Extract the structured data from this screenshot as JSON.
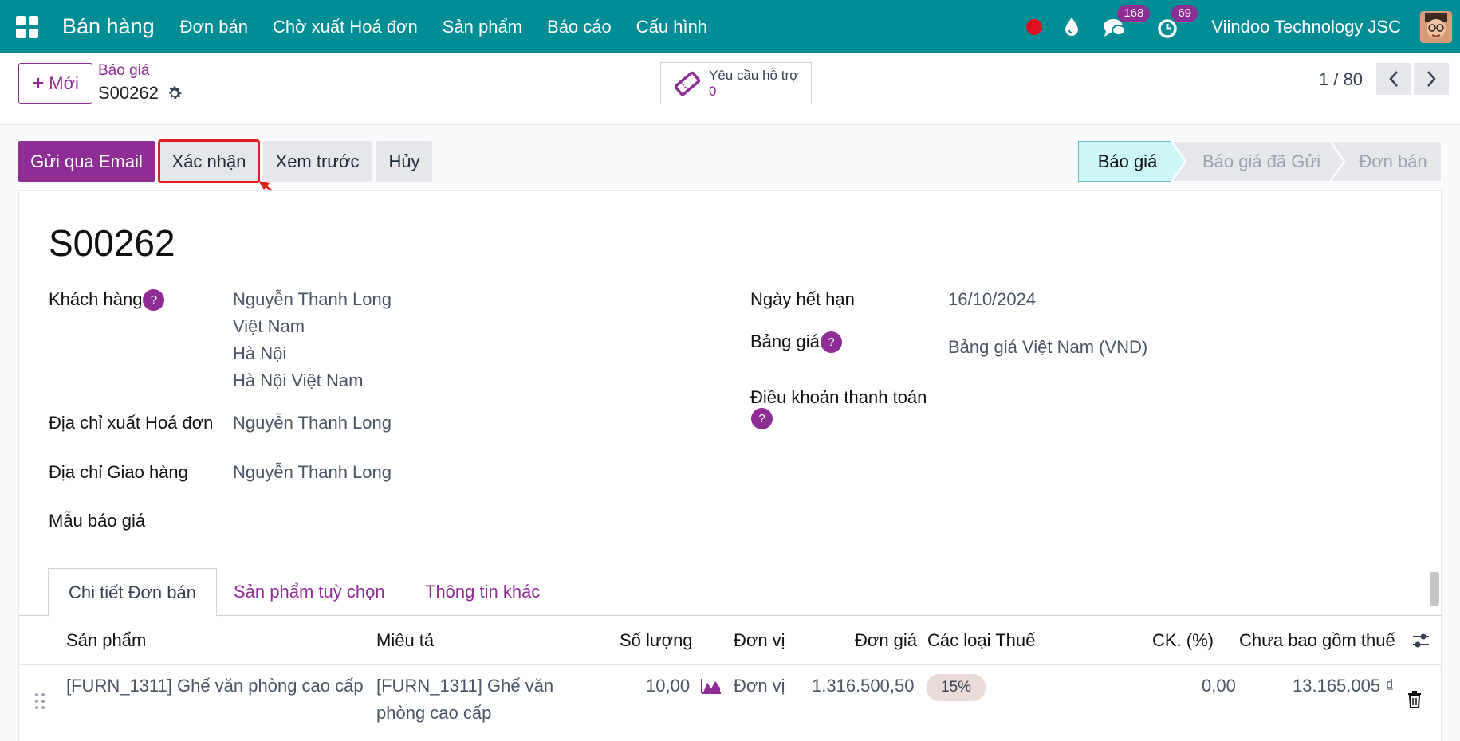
{
  "nav": {
    "app_name": "Bán hàng",
    "menu": [
      "Đơn bán",
      "Chờ xuất Hoá đơn",
      "Sản phẩm",
      "Báo cáo",
      "Cấu hình"
    ],
    "messages_count": "168",
    "activities_count": "69",
    "company": "Viindoo Technology JSC"
  },
  "control": {
    "new_label": "Mới",
    "breadcrumb_parent": "Báo giá",
    "breadcrumb_current": "S00262",
    "support_label": "Yêu cầu hỗ trợ",
    "support_count": "0",
    "pager": "1 / 80"
  },
  "actions": {
    "send_email": "Gửi qua Email",
    "confirm": "Xác nhận",
    "preview": "Xem trước",
    "cancel": "Hủy"
  },
  "status": {
    "stages": [
      "Báo giá",
      "Báo giá đã Gửi",
      "Đơn bán"
    ],
    "active_index": 0
  },
  "form": {
    "name": "S00262",
    "customer_label": "Khách hàng",
    "customer_name": "Nguyễn Thanh Long",
    "customer_line2": "Việt Nam",
    "customer_line3": "Hà Nội",
    "customer_line4": "Hà Nội Việt Nam",
    "invoice_address_label": "Địa chỉ xuất Hoá đơn",
    "invoice_address": "Nguyễn Thanh Long",
    "delivery_address_label": "Địa chỉ Giao hàng",
    "delivery_address": "Nguyễn Thanh Long",
    "template_label": "Mẫu báo giá",
    "expiry_label": "Ngày hết hạn",
    "expiry_value": "16/10/2024",
    "pricelist_label": "Bảng giá",
    "pricelist_value": "Bảng giá Việt Nam (VND)",
    "payment_terms_label": "Điều khoản thanh toán",
    "help_mark": "?"
  },
  "tabs": [
    "Chi tiết Đơn bán",
    "Sản phẩm tuỳ chọn",
    "Thông tin khác"
  ],
  "table": {
    "headers": [
      "Sản phẩm",
      "Miêu tả",
      "Số lượng",
      "Đơn vị",
      "Đơn giá",
      "Các loại Thuế",
      "CK. (%)",
      "Chưa bao gồm thuế"
    ],
    "row": {
      "product": "[FURN_1311] Ghế văn phòng cao cấp",
      "description_line1": "[FURN_1311] Ghế văn",
      "description_line2": "phòng cao cấp",
      "quantity": "10,00",
      "uom": "Đơn vị",
      "price": "1.316.500,50",
      "tax": "15%",
      "discount": "0,00",
      "subtotal": "13.165.005 ₫"
    }
  },
  "colors": {
    "navbar": "#018d95",
    "primary": "#8e2d96",
    "highlight": "#e01e1e",
    "active_stage": "#ccf7f9"
  }
}
